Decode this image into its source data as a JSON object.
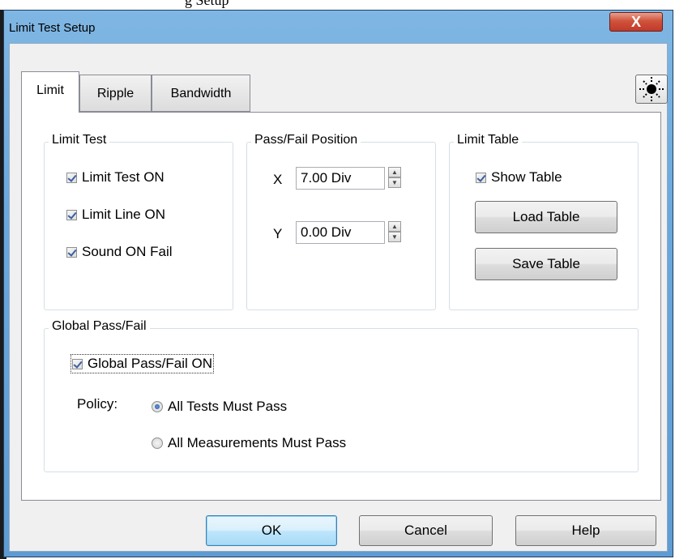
{
  "background": {
    "text": "g  Setup"
  },
  "window": {
    "title": "Limit Test Setup",
    "close_glyph": "X"
  },
  "tabs": [
    {
      "label": "Limit",
      "active": true
    },
    {
      "label": "Ripple",
      "active": false
    },
    {
      "label": "Bandwidth",
      "active": false
    }
  ],
  "theme_button": {
    "icon": "sun-icon",
    "glyph": "☀"
  },
  "limit_test": {
    "title": "Limit Test",
    "items": [
      {
        "label": "Limit Test ON",
        "checked": true
      },
      {
        "label": "Limit Line ON",
        "checked": true
      },
      {
        "label": "Sound ON Fail",
        "checked": true
      }
    ]
  },
  "pass_fail_position": {
    "title": "Pass/Fail Position",
    "x_label": "X",
    "x_value": "7.00 Div",
    "y_label": "Y",
    "y_value": "0.00 Div"
  },
  "limit_table": {
    "title": "Limit Table",
    "show_table_label": "Show Table",
    "show_table_checked": true,
    "load_label": "Load Table",
    "save_label": "Save Table"
  },
  "global_pass_fail": {
    "title": "Global Pass/Fail",
    "on_label": "Global Pass/Fail ON",
    "on_checked": true,
    "policy_label": "Policy:",
    "options": [
      {
        "label": "All Tests Must Pass",
        "selected": true
      },
      {
        "label": "All Measurements Must Pass",
        "selected": false
      }
    ]
  },
  "footer": {
    "ok_label": "OK",
    "cancel_label": "Cancel",
    "help_label": "Help"
  },
  "colors": {
    "title_bar": "#6aa7dc",
    "close_button": "#c0392b",
    "dialog_background": "#f0f0f0",
    "panel_background": "#ffffff",
    "default_button": "#bee6fd"
  }
}
